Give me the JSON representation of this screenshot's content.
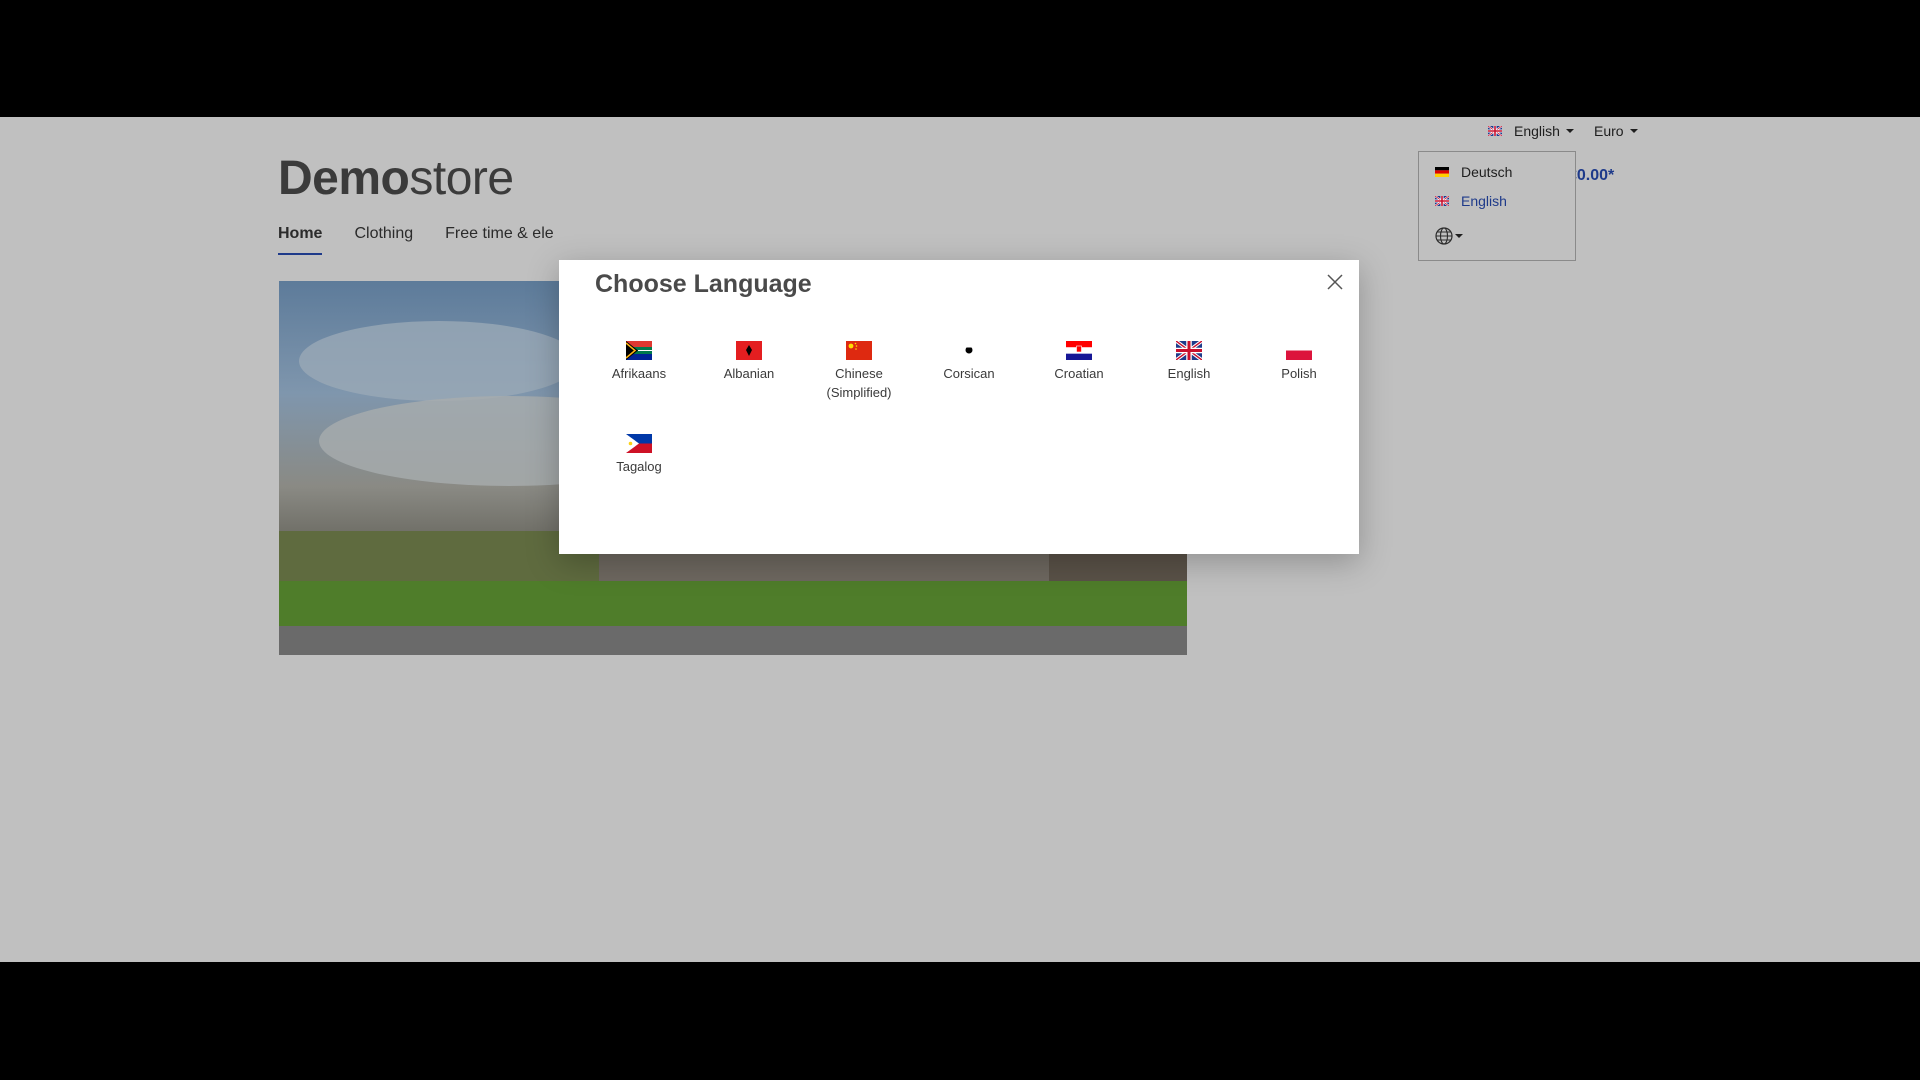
{
  "topbar": {
    "language_label": "English",
    "currency_label": "Euro"
  },
  "header": {
    "logo_bold": "Demo",
    "logo_light": "store",
    "cart_total": "€0.00*"
  },
  "nav": {
    "items": [
      {
        "label": "Home",
        "active": true
      },
      {
        "label": "Clothing"
      },
      {
        "label": "Free time & ele"
      }
    ]
  },
  "language_dropdown": {
    "items": [
      {
        "label": "Deutsch",
        "flag": "german-flag-icon"
      },
      {
        "label": "English",
        "flag": "uk-flag-icon",
        "active": true
      }
    ],
    "globe_icon": "globe-icon"
  },
  "modal": {
    "title": "Choose Language",
    "languages": [
      {
        "label": "Afrikaans",
        "flag": "south-africa-flag-icon"
      },
      {
        "label": "Albanian",
        "flag": "albania-flag-icon"
      },
      {
        "label": "Chinese (Simplified)",
        "flag": "china-flag-icon"
      },
      {
        "label": "Corsican",
        "flag": "corsica-flag-icon"
      },
      {
        "label": "Croatian",
        "flag": "croatia-flag-icon"
      },
      {
        "label": "English",
        "flag": "uk-flag-icon"
      },
      {
        "label": "Polish",
        "flag": "poland-flag-icon"
      },
      {
        "label": "Tagalog",
        "flag": "philippines-flag-icon"
      }
    ]
  },
  "colors": {
    "overlay": "#c0c0c0",
    "accent": "#1e3a8a",
    "modal_bg": "#ffffff"
  }
}
